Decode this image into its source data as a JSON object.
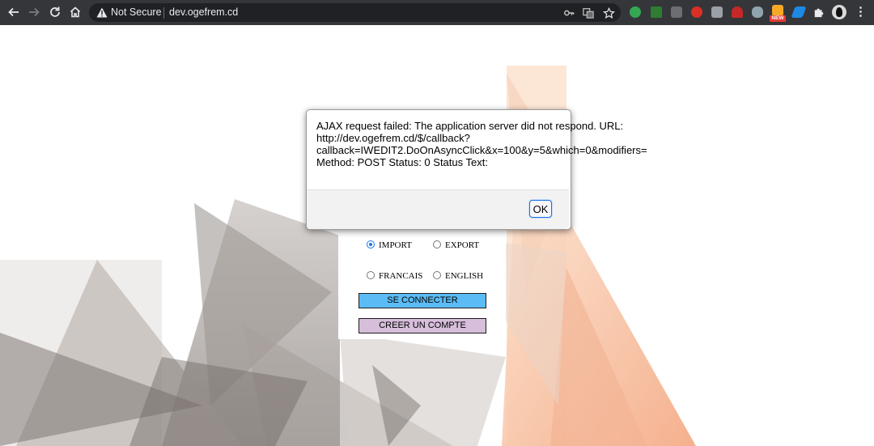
{
  "browser": {
    "security_label": "Not Secure",
    "url": "dev.ogefrem.cd",
    "extension_badge": "NEW",
    "menu_glyph": "⋮"
  },
  "login": {
    "radio_group_1": [
      {
        "label": "IMPORT",
        "checked": true
      },
      {
        "label": "EXPORT",
        "checked": false
      }
    ],
    "radio_group_2": [
      {
        "label": "FRANCAIS",
        "checked": false
      },
      {
        "label": "ENGLISH",
        "checked": false
      }
    ],
    "connect_label": "SE CONNECTER",
    "create_account_label": "CREER UN COMPTE",
    "colors": {
      "connect": "#5bbcf5",
      "create": "#d7bedb"
    }
  },
  "dialog": {
    "message": "AJAX request failed: The application server did not respond. URL:\nhttp://dev.ogefrem.cd/$/callback?\ncallback=IWEDIT2.DoOnAsyncClick&x=100&y=5&which=0&modifiers=\nMethod: POST Status: 0 Status Text:",
    "ok_label": "OK"
  }
}
